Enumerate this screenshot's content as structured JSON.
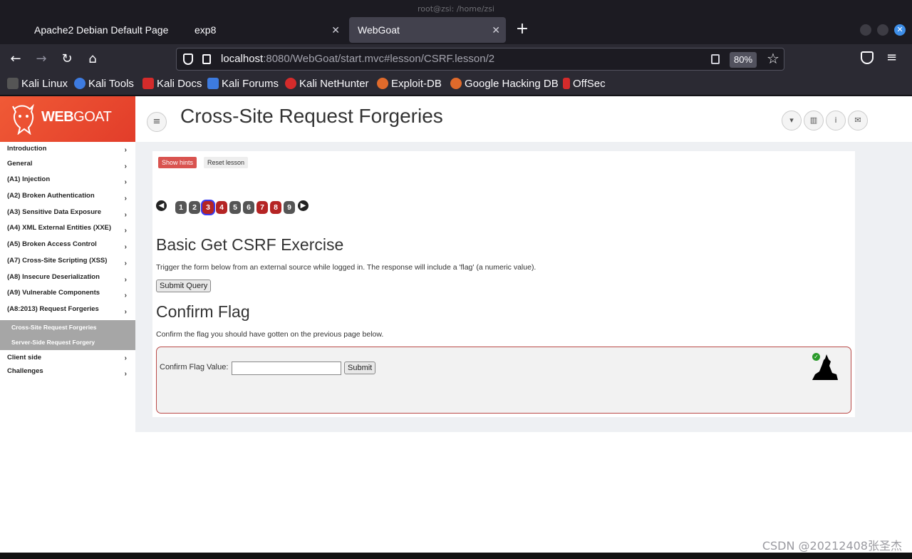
{
  "os": {
    "window_title": "root@zsi: /home/zsi"
  },
  "tabs": [
    {
      "label": "Apache2 Debian Default Page"
    },
    {
      "label": "exp8"
    },
    {
      "label": "WebGoat"
    }
  ],
  "navbar": {
    "url_host": "localhost",
    "url_rest": ":8080/WebGoat/start.mvc#lesson/CSRF.lesson/2",
    "zoom": "80%"
  },
  "bookmarks": [
    {
      "label": "Kali Linux",
      "color": "#2b2a33"
    },
    {
      "label": "Kali Tools",
      "color": "#3d7be0"
    },
    {
      "label": "Kali Docs",
      "color": "#d42b2b"
    },
    {
      "label": "Kali Forums",
      "color": "#3d7be0"
    },
    {
      "label": "Kali NetHunter",
      "color": "#d42b2b"
    },
    {
      "label": "Exploit-DB",
      "color": "#e06a2b"
    },
    {
      "label": "Google Hacking DB",
      "color": "#e06a2b"
    },
    {
      "label": "OffSec",
      "color": "#d42b2b"
    }
  ],
  "logo": {
    "text_bold": "WEB",
    "text_rest": "GOAT"
  },
  "sidebar": {
    "items": [
      "Introduction",
      "General",
      "(A1) Injection",
      "(A2) Broken Authentication",
      "(A3) Sensitive Data Exposure",
      "(A4) XML External Entities (XXE)",
      "(A5) Broken Access Control",
      "(A7) Cross-Site Scripting (XSS)",
      "(A8) Insecure Deserialization",
      "(A9) Vulnerable Components",
      "(A8:2013) Request Forgeries"
    ],
    "subitems": [
      "Cross-Site Request Forgeries",
      "Server-Side Request Forgery"
    ],
    "items_after": [
      "Client side",
      "Challenges"
    ]
  },
  "header": {
    "title": "Cross-Site Request Forgeries"
  },
  "lesson": {
    "show_hints": "Show hints",
    "reset_lesson": "Reset lesson",
    "pages": [
      {
        "n": "1",
        "state": "gray"
      },
      {
        "n": "2",
        "state": "gray"
      },
      {
        "n": "3",
        "state": "cur"
      },
      {
        "n": "4",
        "state": "red"
      },
      {
        "n": "5",
        "state": "gray"
      },
      {
        "n": "6",
        "state": "gray"
      },
      {
        "n": "7",
        "state": "red"
      },
      {
        "n": "8",
        "state": "red"
      },
      {
        "n": "9",
        "state": "gray"
      }
    ],
    "section1_title": "Basic Get CSRF Exercise",
    "section1_text": "Trigger the form below from an external source while logged in. The response will include a 'flag' (a numeric value).",
    "submit_query": "Submit Query",
    "section2_title": "Confirm Flag",
    "section2_text": "Confirm the flag you should have gotten on the previous page below.",
    "flag_label": "Confirm Flag Value:",
    "flag_value": "",
    "submit": "Submit"
  },
  "watermark": "CSDN @20212408张圣杰"
}
